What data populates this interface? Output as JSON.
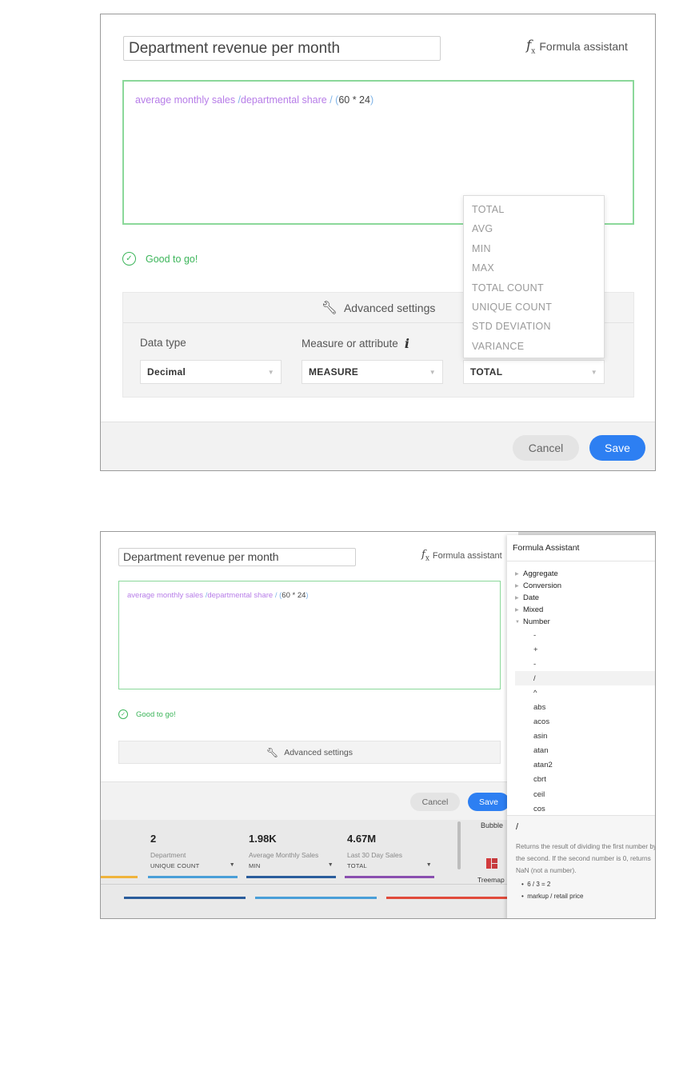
{
  "panel1": {
    "name": "Department revenue per month",
    "formula_assistant": "Formula assistant",
    "formula": {
      "part1": "average monthly sales",
      "part2": " /",
      "part3": "departmental share",
      "part4": " / ",
      "part5": "(",
      "part6": "60 * 24",
      "part7": ")"
    },
    "status": "Good to go!",
    "advanced_settings": "Advanced settings",
    "data_type_label": "Data type",
    "measure_label": "Measure or attribute",
    "data_type_value": "Decimal",
    "measure_value": "MEASURE",
    "aggregation_value": "TOTAL",
    "aggregation_options": [
      "TOTAL",
      "AVG",
      "MIN",
      "MAX",
      "TOTAL COUNT",
      "UNIQUE COUNT",
      "STD DEVIATION",
      "VARIANCE"
    ],
    "cancel": "Cancel",
    "save": "Save"
  },
  "panel2": {
    "name": "Department revenue per month",
    "formula_assistant": "Formula assistant",
    "status": "Good to go!",
    "advanced_settings": "Advanced settings",
    "cancel": "Cancel",
    "save": "Save",
    "stats": [
      {
        "value": "2",
        "label": "Department",
        "agg": "UNIQUE COUNT",
        "color": "#4a9fd8"
      },
      {
        "value": "1.98K",
        "label": "Average Monthly Sales",
        "agg": "MIN",
        "color": "#2b5d9c"
      },
      {
        "value": "4.67M",
        "label": "Last 30 Day Sales",
        "agg": "TOTAL",
        "color": "#8a4fb0"
      }
    ],
    "chart_types": [
      "Bubble",
      "Treemap"
    ],
    "assistant": {
      "title": "Formula Assistant",
      "categories": [
        "Aggregate",
        "Conversion",
        "Date",
        "Mixed",
        "Number"
      ],
      "functions": [
        "-",
        "+",
        "-",
        "/",
        "^",
        "abs",
        "acos",
        "asin",
        "atan",
        "atan2",
        "cbrt",
        "ceil",
        "cos"
      ],
      "selected_function": "/",
      "detail_title": "/",
      "detail_desc": "Returns the result of dividing the first number by the second. If the second number is 0, returns NaN (not a number).",
      "examples": [
        "6 / 3 = 2",
        "markup / retail price"
      ]
    }
  },
  "colors": {
    "accent_blue": "#2d7ff2",
    "success_green": "#3cb55a",
    "editor_border": "#8bd89a",
    "formula_purple": "#b77de8",
    "formula_blue": "#7fb4e8"
  }
}
